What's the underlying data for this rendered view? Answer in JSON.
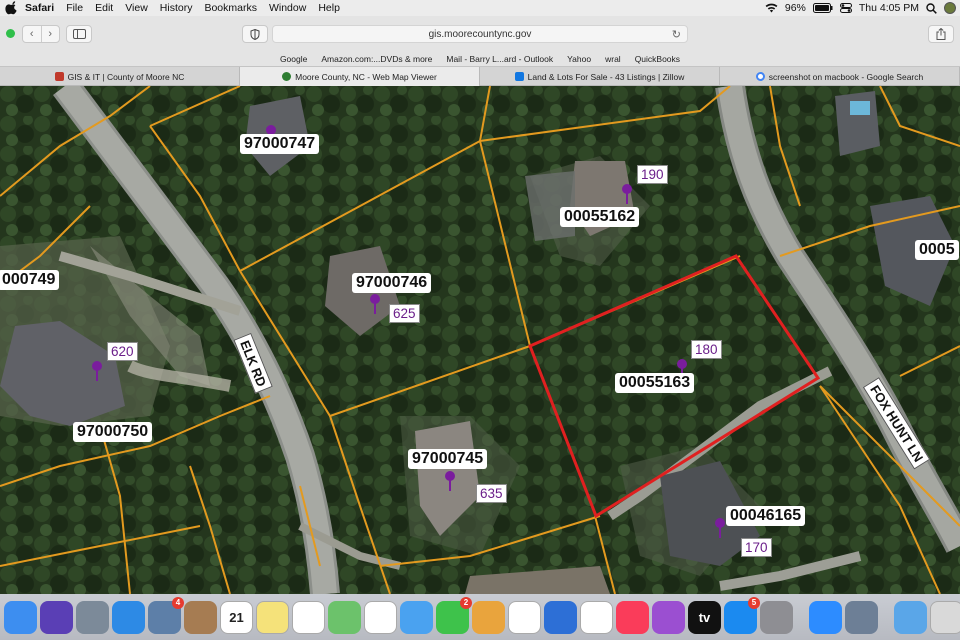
{
  "menubar": {
    "app": "Safari",
    "items": [
      "File",
      "Edit",
      "View",
      "History",
      "Bookmarks",
      "Window",
      "Help"
    ],
    "battery": "96%",
    "clock": "Thu 4:05 PM"
  },
  "toolbar": {
    "url": "gis.moorecountync.gov"
  },
  "favorites": [
    "Google",
    "Amazon.com:...DVDs & more",
    "Mail - Barry L...ard - Outlook",
    "Yahoo",
    "wral",
    "QuickBooks"
  ],
  "tabs": [
    {
      "label": "GIS & IT | County of Moore NC",
      "icon": "gis-favicon-icon",
      "color": "#c0392b",
      "active": false
    },
    {
      "label": "Moore County, NC - Web Map Viewer",
      "icon": "map-viewer-favicon-icon",
      "color": "#2e7d32",
      "active": true
    },
    {
      "label": "Land & Lots For Sale - 43 Listings | Zillow",
      "icon": "zillow-favicon-icon",
      "color": "#1277e1",
      "active": false
    },
    {
      "label": "screenshot on macbook - Google Search",
      "icon": "google-favicon-icon",
      "color": "#4285f4",
      "active": false
    }
  ],
  "map": {
    "selected_parcel_color": "#e02020",
    "parcel_line_color": "#e39a1f",
    "roads": [
      "ELK RD",
      "FOX HUNT LN"
    ],
    "parcels": [
      {
        "id": "97000747",
        "address": ""
      },
      {
        "id": "00055162",
        "address": "190"
      },
      {
        "id": "97000746",
        "address": "625"
      },
      {
        "id": "000749",
        "address": ""
      },
      {
        "id": "00055163",
        "address": "180",
        "selected": true
      },
      {
        "id": "97000750",
        "address": "620"
      },
      {
        "id": "97000745",
        "address": "635"
      },
      {
        "id": "00046165",
        "address": "170"
      },
      {
        "id": "0005",
        "address": ""
      }
    ]
  },
  "dock": {
    "apps": [
      {
        "name": "finder-icon",
        "color": "#3d8ef0"
      },
      {
        "name": "siri-icon",
        "color": "#5a3fb5"
      },
      {
        "name": "launchpad-icon",
        "color": "#7c8a99"
      },
      {
        "name": "safari-icon",
        "color": "#2d8ae5"
      },
      {
        "name": "preview-icon",
        "color": "#5d7fa8",
        "badge": "4"
      },
      {
        "name": "notefile-icon",
        "color": "#a67c52"
      },
      {
        "name": "calendar-icon",
        "color": "#ffffff",
        "text": "21"
      },
      {
        "name": "notes-icon",
        "color": "#f5e27a"
      },
      {
        "name": "reminders-icon",
        "color": "#ffffff"
      },
      {
        "name": "maps-icon",
        "color": "#6cc26b"
      },
      {
        "name": "photos-icon",
        "color": "#ffffff"
      },
      {
        "name": "messages-bubble-icon",
        "color": "#4aa2f0"
      },
      {
        "name": "facetime-icon",
        "color": "#3ec24b",
        "badge": "2"
      },
      {
        "name": "keynote-pen-icon",
        "color": "#e9a43d"
      },
      {
        "name": "numbers-icon",
        "color": "#ffffff"
      },
      {
        "name": "keynote-icon",
        "color": "#2d6fd6"
      },
      {
        "name": "news-icon",
        "color": "#ffffff"
      },
      {
        "name": "music-icon",
        "color": "#fa3c5a"
      },
      {
        "name": "podcasts-icon",
        "color": "#9b4fd1"
      },
      {
        "name": "tv-icon",
        "color": "#111111",
        "text": "tv"
      },
      {
        "name": "app-store-icon",
        "color": "#1b8af0",
        "badge": "5"
      },
      {
        "name": "system-preferences-icon",
        "color": "#8e8e93"
      },
      {
        "name": "zoom-icon",
        "color": "#2d8cff"
      },
      {
        "name": "image-capture-icon",
        "color": "#6d7f96"
      },
      {
        "name": "downloads-folder-icon",
        "color": "#5aa6e8"
      },
      {
        "name": "trash-icon",
        "color": "#d9d9d9"
      }
    ]
  }
}
